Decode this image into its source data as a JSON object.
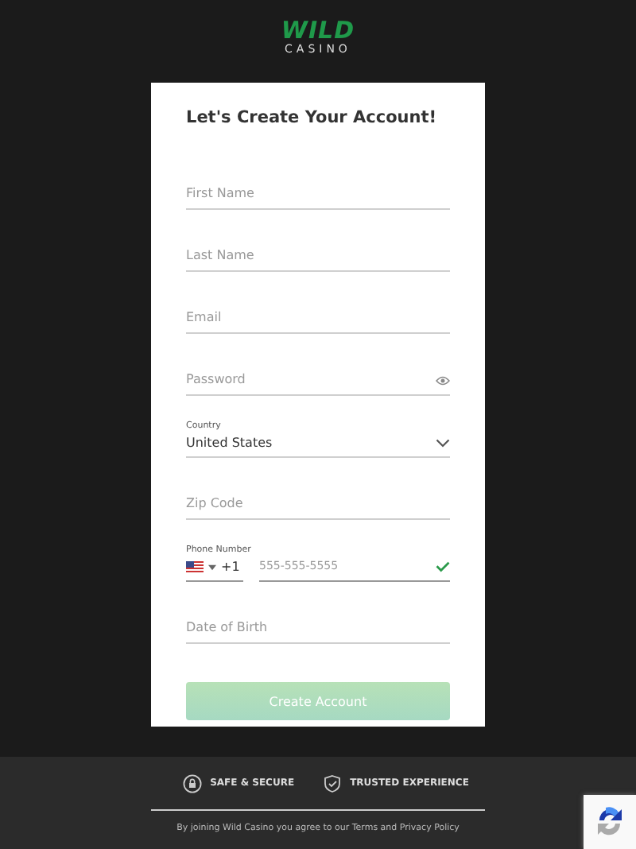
{
  "logo": {
    "word": "WILD",
    "subword": "CASINO"
  },
  "form": {
    "title": "Let's Create Your Account!",
    "fields": [
      {
        "kind": "text",
        "placeholder": "First Name"
      },
      {
        "kind": "text",
        "placeholder": "Last Name"
      },
      {
        "kind": "text",
        "placeholder": "Email"
      },
      {
        "kind": "password",
        "placeholder": "Password"
      },
      {
        "kind": "select",
        "label": "Country",
        "value": "United States"
      },
      {
        "kind": "text",
        "placeholder": "Zip Code"
      },
      {
        "kind": "phone",
        "label": "Phone Number",
        "code": "+1",
        "placeholder": "555-555-5555",
        "valid": true
      },
      {
        "kind": "text",
        "placeholder": "Date of Birth"
      }
    ],
    "submit": {
      "label": "Create Account",
      "disabled": true
    }
  },
  "footer": {
    "badges": [
      {
        "kind": "lock",
        "label": "SAFE & SECURE"
      },
      {
        "kind": "shield",
        "label": "TRUSTED EXPERIENCE"
      }
    ],
    "notice_before": "By joining Wild Casino you agree to our ",
    "terms_link": "Terms",
    "notice_middle": " and ",
    "privacy_link": "Privacy Policy"
  }
}
